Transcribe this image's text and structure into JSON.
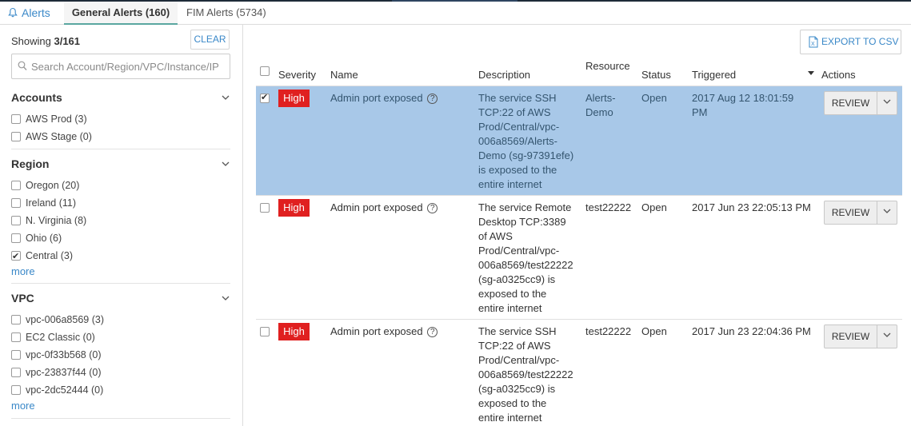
{
  "tabs": {
    "alerts": "Alerts",
    "general": "General Alerts (160)",
    "fim": "FIM Alerts (5734)"
  },
  "sidebar": {
    "showing_prefix": "Showing ",
    "showing_count": "3/161",
    "clear": "CLEAR",
    "search_placeholder": "Search Account/Region/VPC/Instance/IP",
    "sections": [
      {
        "title": "Accounts",
        "items": [
          {
            "label": "AWS Prod (3)",
            "checked": false
          },
          {
            "label": "AWS Stage (0)",
            "checked": false
          }
        ]
      },
      {
        "title": "Region",
        "items": [
          {
            "label": "Oregon (20)",
            "checked": false
          },
          {
            "label": "Ireland (11)",
            "checked": false
          },
          {
            "label": "N. Virginia (8)",
            "checked": false
          },
          {
            "label": "Ohio (6)",
            "checked": false
          },
          {
            "label": "Central (3)",
            "checked": true
          }
        ],
        "more": "more"
      },
      {
        "title": "VPC",
        "items": [
          {
            "label": "vpc-006a8569 (3)",
            "checked": false
          },
          {
            "label": "EC2 Classic (0)",
            "checked": false
          },
          {
            "label": "vpc-0f33b568 (0)",
            "checked": false
          },
          {
            "label": "vpc-23837f44 (0)",
            "checked": false
          },
          {
            "label": "vpc-2dc52444 (0)",
            "checked": false
          }
        ],
        "more": "more"
      }
    ]
  },
  "toolbar": {
    "export": "EXPORT TO CSV"
  },
  "table": {
    "headers": {
      "severity": "Severity",
      "name": "Name",
      "description": "Description",
      "resource": "Resource",
      "status": "Status",
      "triggered": "Triggered",
      "actions": "Actions"
    },
    "rows": [
      {
        "selected": true,
        "severity": "High",
        "name": "Admin port exposed",
        "description": [
          "The service SSH",
          "TCP:22 of AWS",
          "Prod/Central/vpc-",
          "006a8569/Alerts-",
          "Demo (sg-97391efe)",
          "is exposed to the",
          "entire internet"
        ],
        "resource": [
          "Alerts-",
          "Demo"
        ],
        "status": "Open",
        "triggered": [
          "2017 Aug 12 18:01:59",
          "PM"
        ],
        "action": "REVIEW"
      },
      {
        "selected": false,
        "severity": "High",
        "name": "Admin port exposed",
        "description": [
          "The service Remote",
          "Desktop TCP:3389",
          "of AWS",
          "Prod/Central/vpc-",
          "006a8569/test22222",
          "(sg-a0325cc9) is",
          "exposed to the",
          "entire internet"
        ],
        "resource": [
          "test22222"
        ],
        "status": "Open",
        "triggered": [
          "2017 Jun 23 22:05:13 PM"
        ],
        "action": "REVIEW"
      },
      {
        "selected": false,
        "severity": "High",
        "name": "Admin port exposed",
        "description": [
          "The service SSH",
          "TCP:22 of AWS",
          "Prod/Central/vpc-",
          "006a8569/test22222",
          "(sg-a0325cc9) is",
          "exposed to the",
          "entire internet"
        ],
        "resource": [
          "test22222"
        ],
        "status": "Open",
        "triggered": [
          "2017 Jun 23 22:04:36 PM"
        ],
        "action": "REVIEW"
      }
    ]
  },
  "colors": {
    "accent": "#3a88c8",
    "severity_high": "#e02020",
    "selected_row": "#a8c8e8"
  }
}
